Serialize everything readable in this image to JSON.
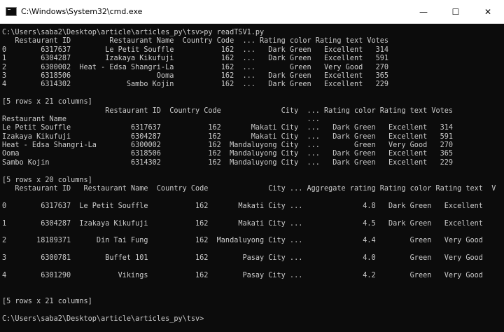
{
  "window": {
    "title": "C:\\Windows\\System32\\cmd.exe",
    "minimize": "—",
    "maximize": "☐",
    "close": "✕"
  },
  "console": {
    "lines": [
      "C:\\Users\\saba2\\Desktop\\article\\articles_py\\tsv>py readTSV1.py",
      "   Restaurant ID         Restaurant Name  Country Code  ... Rating color Rating text Votes",
      "0        6317637        Le Petit Souffle           162  ...   Dark Green   Excellent   314",
      "1        6304287        Izakaya Kikufuji           162  ...   Dark Green   Excellent   591",
      "2        6300002  Heat - Edsa Shangri-La           162  ...        Green   Very Good   270",
      "3        6318506                    Ooma           162  ...   Dark Green   Excellent   365",
      "4        6314302             Sambo Kojin           162  ...   Dark Green   Excellent   229",
      "",
      "[5 rows x 21 columns]",
      "                        Restaurant ID  Country Code              City  ... Rating color Rating text Votes",
      "Restaurant Name                                                        ...",
      "Le Petit Souffle              6317637           162       Makati City  ...   Dark Green   Excellent   314",
      "Izakaya Kikufuji              6304287           162       Makati City  ...   Dark Green   Excellent   591",
      "Heat - Edsa Shangri-La        6300002           162  Mandaluyong City  ...        Green   Very Good   270",
      "Ooma                          6318506           162  Mandaluyong City  ...   Dark Green   Excellent   365",
      "Sambo Kojin                   6314302           162  Mandaluyong City  ...   Dark Green   Excellent   229",
      "",
      "[5 rows x 20 columns]",
      "   Restaurant ID   Restaurant Name  Country Code              City ... Aggregate rating Rating color Rating text  V",
      "",
      "0        6317637  Le Petit Souffle           162       Makati City ...              4.8   Dark Green   Excellent",
      "",
      "1        6304287  Izakaya Kikufuji           162       Makati City ...              4.5   Dark Green   Excellent",
      "",
      "2       18189371      Din Tai Fung           162  Mandaluyong City ...              4.4        Green   Very Good",
      "",
      "3        6300781        Buffet 101           162        Pasay City ...              4.0        Green   Very Good",
      "",
      "4        6301290           Vikings           162        Pasay City ...              4.2        Green   Very Good",
      "",
      "",
      "[5 rows x 21 columns]",
      "",
      "C:\\Users\\saba2\\Desktop\\article\\articles_py\\tsv>"
    ]
  }
}
